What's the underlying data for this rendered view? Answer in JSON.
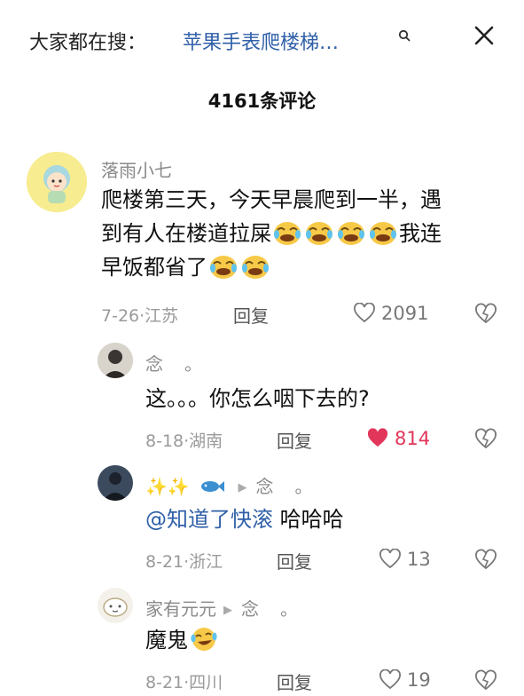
{
  "search": {
    "prefix": "大家都在搜：",
    "term": "苹果手表爬楼梯…"
  },
  "comments_title": "4161条评论",
  "comments": [
    {
      "user": "落雨小七",
      "text_line1": "爬楼第三天，今天早晨爬到一半，遇",
      "text_line2_a": "到有人在楼道拉屎",
      "text_line2_b": "我连",
      "text_line3": "早饭都省了",
      "meta": "7-26·江苏",
      "reply_label": "回复",
      "likes": "2091",
      "liked": false
    },
    {
      "user": "念",
      "user_suffix": "。",
      "text": "这。。。你怎么咽下去的?",
      "meta": "8-18·湖南",
      "reply_label": "回复",
      "likes": "814",
      "liked": true
    },
    {
      "user_sparkles": "✨✨",
      "reply_to": "念",
      "reply_to_suffix": "。",
      "mention": "@知道了快滚",
      "text": " 哈哈哈",
      "meta": "8-21·浙江",
      "reply_label": "回复",
      "likes": "13",
      "liked": false
    },
    {
      "user": "家有元元",
      "reply_to": "念",
      "reply_to_suffix": "。",
      "text": "魔鬼",
      "meta": "8-21·四川",
      "reply_label": "回复",
      "likes": "19",
      "liked": false
    }
  ],
  "colors": {
    "link_blue": "#2f5fa8",
    "like_red": "#e1365a",
    "meta_gray": "#9a9a9a"
  }
}
